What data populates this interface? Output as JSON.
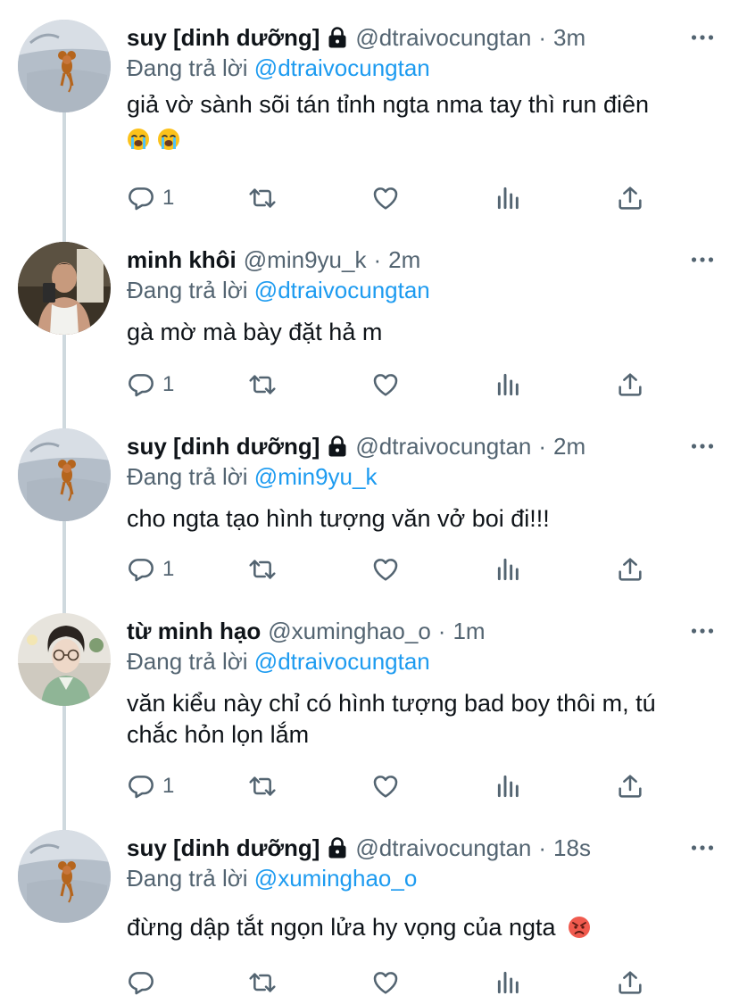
{
  "tweets": [
    {
      "name": "suy [dinh dưỡng]",
      "handle": "@dtraivocungtan",
      "time": "3m",
      "replying_prefix": "Đang trả lời",
      "replying_to": "@dtraivocungtan",
      "text_lines": [
        "giả vờ sành sõi tán tỉnh ngta nma tay thì run điên"
      ],
      "emoji": [
        "loudly-crying-face",
        "loudly-crying-face"
      ],
      "reply_count": "1",
      "locked": true,
      "avatar": "jerry-mouse"
    },
    {
      "name": "minh khôi",
      "handle": "@min9yu_k",
      "time": "2m",
      "replying_prefix": "Đang trả lời",
      "replying_to": "@dtraivocungtan",
      "text_lines": [
        "gà mờ mà bày đặt hả m"
      ],
      "reply_count": "1",
      "locked": false,
      "avatar": "mirror-selfie"
    },
    {
      "name": "suy [dinh dưỡng]",
      "handle": "@dtraivocungtan",
      "time": "2m",
      "replying_prefix": "Đang trả lời",
      "replying_to": "@min9yu_k",
      "text_lines": [
        "cho ngta tạo hình tượng văn vở boi đi!!!"
      ],
      "reply_count": "1",
      "locked": true,
      "avatar": "jerry-mouse"
    },
    {
      "name": "từ minh hạo",
      "handle": "@xuminghao_o",
      "time": "1m",
      "replying_prefix": "Đang trả lời",
      "replying_to": "@dtraivocungtan",
      "text_lines": [
        "văn kiểu này chỉ có hình tượng bad boy thôi m, tú",
        "chắc hỏn lọn lắm"
      ],
      "reply_count": "1",
      "locked": false,
      "avatar": "glasses-portrait"
    },
    {
      "name": "suy [dinh dưỡng]",
      "handle": "@dtraivocungtan",
      "time": "18s",
      "replying_prefix": "Đang trả lời",
      "replying_to": "@xuminghao_o",
      "text_lines": [
        "đừng dập tắt ngọn lửa hy vọng của ngta"
      ],
      "emoji_inline": "angry-face",
      "reply_count": "",
      "locked": true,
      "avatar": "jerry-mouse"
    }
  ],
  "separator": "·",
  "colors": {
    "text": "#0f1419",
    "secondary": "#536471",
    "accent": "#1d9bf0",
    "thread_line": "#cfd9de"
  },
  "icons": [
    "reply-icon",
    "retweet-icon",
    "like-icon",
    "analytics-icon",
    "share-icon",
    "more-icon",
    "lock-icon"
  ]
}
